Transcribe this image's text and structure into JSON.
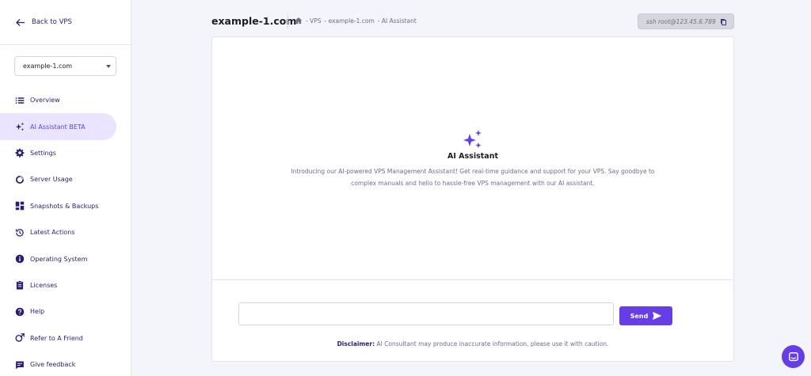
{
  "sidebar": {
    "back_label": "Back to VPS",
    "domain_select": {
      "value": "example-1.com"
    },
    "items": [
      {
        "label": "Overview",
        "icon": "list-icon",
        "active": false
      },
      {
        "label": "AI Assistant BETA",
        "icon": "sparkle-icon",
        "active": true
      },
      {
        "label": "Settings",
        "icon": "gear-icon",
        "active": false
      },
      {
        "label": "Server Usage",
        "icon": "chart-ring-icon",
        "active": false
      },
      {
        "label": "Snapshots & Backups",
        "icon": "grid-icon",
        "active": false
      },
      {
        "label": "Latest Actions",
        "icon": "history-icon",
        "active": false
      },
      {
        "label": "Operating System",
        "icon": "info-icon",
        "active": false
      },
      {
        "label": "Licenses",
        "icon": "clipboard-icon",
        "active": false
      },
      {
        "label": "Help",
        "icon": "help-icon",
        "active": false
      },
      {
        "label": "Refer to A Friend",
        "icon": "refer-icon",
        "active": false
      },
      {
        "label": "Give feedback",
        "icon": "feedback-icon",
        "active": false
      }
    ]
  },
  "header": {
    "title": "example-1.com",
    "breadcrumb": [
      "- VPS",
      "- example-1.com",
      "- AI Assistant"
    ],
    "ssh": "ssh root@123.45.6.789"
  },
  "main": {
    "assistant_title": "AI Assistant",
    "description": "Introducing our AI-powered VPS Management Assistant! Get real-time guidance and support for your VPS. Say goodbye to complex manuals and hello to hassle-free VPS management with our AI assistant.",
    "input_value": "",
    "send_label": "Send",
    "disclaimer_label": "Disclaimer:",
    "disclaimer_text": "AI Consultant may produce inaccurate information, please use it with caution."
  },
  "colors": {
    "accent": "#673de6",
    "active_bg": "#ebe4ff",
    "nav_text": "#2f1c6a",
    "page_bg": "#f4f4fb"
  }
}
